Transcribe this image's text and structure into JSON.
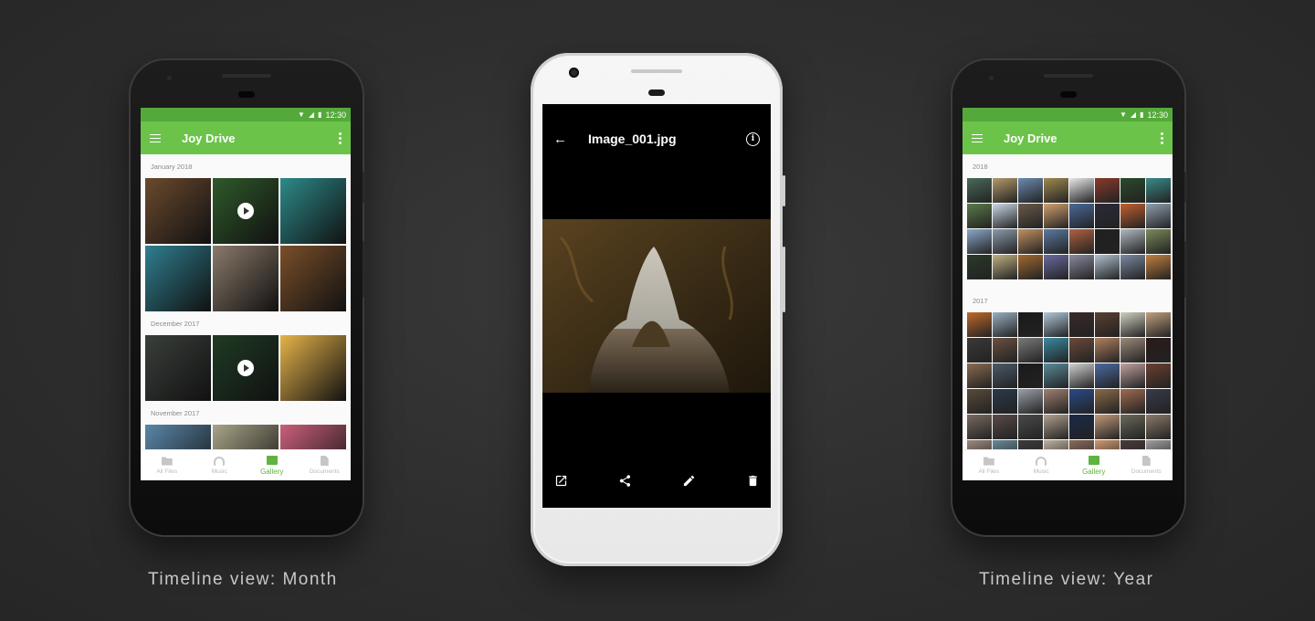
{
  "status_time": "12:30",
  "left_phone": {
    "app_title": "Joy Drive",
    "sections": [
      {
        "label": "January 2018",
        "tiles": [
          "#6b4a2e",
          "#2f5a2a",
          "#2d8a8a",
          "#2f7f8f",
          "#8a7a6a",
          "#7a4f2a"
        ],
        "video_index": 1
      },
      {
        "label": "December 2017",
        "tiles": [
          "#3a3f3b",
          "#1f3b24",
          "#e6b34a"
        ],
        "video_index": 1
      },
      {
        "label": "November 2017",
        "tiles": [
          "#5a87a8",
          "#a9a488",
          "#c9607a"
        ],
        "video_index": -1
      }
    ],
    "nav": [
      "All Files",
      "Music",
      "Gallery",
      "Documents"
    ],
    "active_nav": 2,
    "caption": "Timeline view: Month"
  },
  "center_phone": {
    "file_name": "Image_001.jpg",
    "actions": [
      "open-external-icon",
      "share-icon",
      "edit-icon",
      "delete-icon"
    ]
  },
  "right_phone": {
    "app_title": "Joy Drive",
    "sections": [
      {
        "label": "2018",
        "colors": [
          "#4a6a5a",
          "#b39a6a",
          "#6b8ab0",
          "#a08a50",
          "#e8e8e8",
          "#8a3a2a",
          "#2a4a2a",
          "#3a8a8a",
          "#5a7a4a",
          "#c8d8e8",
          "#6a5a4a",
          "#d0a070",
          "#4a6a9a",
          "#2a2a3a",
          "#c06030",
          "#90a0b0",
          "#8aa8c8",
          "#8a9aaa",
          "#c09060",
          "#5a7aa0",
          "#b06040",
          "#202020",
          "#b0b8c0",
          "#7a8a5a",
          "#2a3a2a",
          "#c0b080",
          "#a06a30",
          "#6a6aa0",
          "#8a8aa0",
          "#b0c0d0",
          "#7a8aa0",
          "#c08040"
        ]
      },
      {
        "label": "2017",
        "colors": [
          "#c06a2a",
          "#9ab0c0",
          "#1a1a1a",
          "#b0c8d8",
          "#3a2a2a",
          "#5a4030",
          "#d0d0c0",
          "#c0a080",
          "#3a3a3a",
          "#6a5040",
          "#7a7a7a",
          "#3a8aa0",
          "#6a4a3a",
          "#b08060",
          "#9a8a7a",
          "#2a1a1a",
          "#8a6a50",
          "#4a5a6a",
          "#1a1a1a",
          "#5a8a9a",
          "#d0d0d0",
          "#4a6aa0",
          "#c0a0a0",
          "#6a4030",
          "#5a4a3a",
          "#2a3a4a",
          "#9aa0a8",
          "#a08070",
          "#2a4a8a",
          "#8a6a4a",
          "#a06a50",
          "#3a3a4a",
          "#7a6a60",
          "#5a4a4a",
          "#4a4a4a",
          "#b0a090",
          "#1a2a4a",
          "#c09a7a",
          "#6a6a5a",
          "#8a7a6a",
          "#a08a80",
          "#6a8a9a",
          "#3a3a3a",
          "#c0b0a0",
          "#8a6a5a",
          "#d09a70",
          "#4a3a3a",
          "#a0a0a0"
        ]
      }
    ],
    "nav": [
      "All Files",
      "Music",
      "Gallery",
      "Documents"
    ],
    "active_nav": 2,
    "caption": "Timeline view: Year"
  }
}
